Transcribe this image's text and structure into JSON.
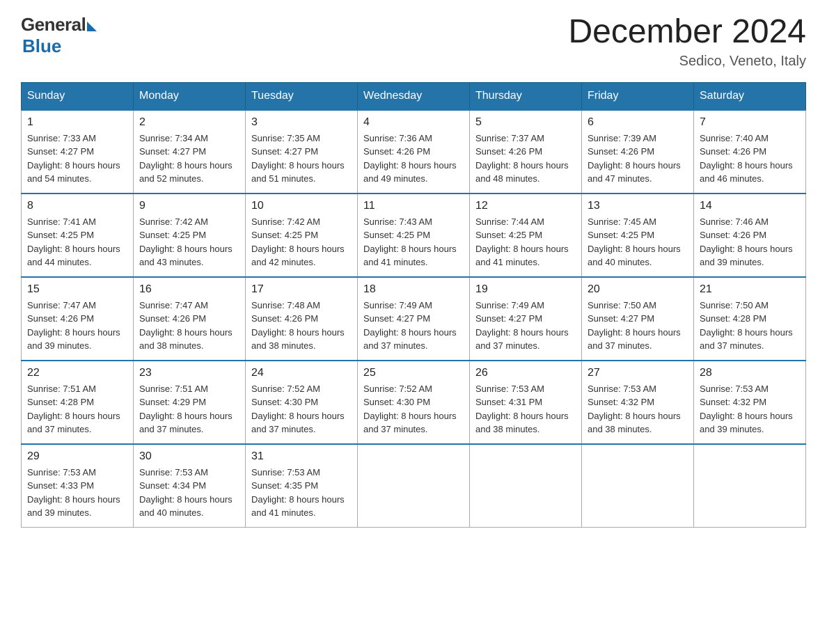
{
  "logo": {
    "general": "General",
    "blue": "Blue",
    "subtitle": "Blue"
  },
  "header": {
    "month": "December 2024",
    "location": "Sedico, Veneto, Italy"
  },
  "days_of_week": [
    "Sunday",
    "Monday",
    "Tuesday",
    "Wednesday",
    "Thursday",
    "Friday",
    "Saturday"
  ],
  "weeks": [
    [
      {
        "day": "1",
        "sunrise": "7:33 AM",
        "sunset": "4:27 PM",
        "daylight": "8 hours and 54 minutes."
      },
      {
        "day": "2",
        "sunrise": "7:34 AM",
        "sunset": "4:27 PM",
        "daylight": "8 hours and 52 minutes."
      },
      {
        "day": "3",
        "sunrise": "7:35 AM",
        "sunset": "4:27 PM",
        "daylight": "8 hours and 51 minutes."
      },
      {
        "day": "4",
        "sunrise": "7:36 AM",
        "sunset": "4:26 PM",
        "daylight": "8 hours and 49 minutes."
      },
      {
        "day": "5",
        "sunrise": "7:37 AM",
        "sunset": "4:26 PM",
        "daylight": "8 hours and 48 minutes."
      },
      {
        "day": "6",
        "sunrise": "7:39 AM",
        "sunset": "4:26 PM",
        "daylight": "8 hours and 47 minutes."
      },
      {
        "day": "7",
        "sunrise": "7:40 AM",
        "sunset": "4:26 PM",
        "daylight": "8 hours and 46 minutes."
      }
    ],
    [
      {
        "day": "8",
        "sunrise": "7:41 AM",
        "sunset": "4:25 PM",
        "daylight": "8 hours and 44 minutes."
      },
      {
        "day": "9",
        "sunrise": "7:42 AM",
        "sunset": "4:25 PM",
        "daylight": "8 hours and 43 minutes."
      },
      {
        "day": "10",
        "sunrise": "7:42 AM",
        "sunset": "4:25 PM",
        "daylight": "8 hours and 42 minutes."
      },
      {
        "day": "11",
        "sunrise": "7:43 AM",
        "sunset": "4:25 PM",
        "daylight": "8 hours and 41 minutes."
      },
      {
        "day": "12",
        "sunrise": "7:44 AM",
        "sunset": "4:25 PM",
        "daylight": "8 hours and 41 minutes."
      },
      {
        "day": "13",
        "sunrise": "7:45 AM",
        "sunset": "4:25 PM",
        "daylight": "8 hours and 40 minutes."
      },
      {
        "day": "14",
        "sunrise": "7:46 AM",
        "sunset": "4:26 PM",
        "daylight": "8 hours and 39 minutes."
      }
    ],
    [
      {
        "day": "15",
        "sunrise": "7:47 AM",
        "sunset": "4:26 PM",
        "daylight": "8 hours and 39 minutes."
      },
      {
        "day": "16",
        "sunrise": "7:47 AM",
        "sunset": "4:26 PM",
        "daylight": "8 hours and 38 minutes."
      },
      {
        "day": "17",
        "sunrise": "7:48 AM",
        "sunset": "4:26 PM",
        "daylight": "8 hours and 38 minutes."
      },
      {
        "day": "18",
        "sunrise": "7:49 AM",
        "sunset": "4:27 PM",
        "daylight": "8 hours and 37 minutes."
      },
      {
        "day": "19",
        "sunrise": "7:49 AM",
        "sunset": "4:27 PM",
        "daylight": "8 hours and 37 minutes."
      },
      {
        "day": "20",
        "sunrise": "7:50 AM",
        "sunset": "4:27 PM",
        "daylight": "8 hours and 37 minutes."
      },
      {
        "day": "21",
        "sunrise": "7:50 AM",
        "sunset": "4:28 PM",
        "daylight": "8 hours and 37 minutes."
      }
    ],
    [
      {
        "day": "22",
        "sunrise": "7:51 AM",
        "sunset": "4:28 PM",
        "daylight": "8 hours and 37 minutes."
      },
      {
        "day": "23",
        "sunrise": "7:51 AM",
        "sunset": "4:29 PM",
        "daylight": "8 hours and 37 minutes."
      },
      {
        "day": "24",
        "sunrise": "7:52 AM",
        "sunset": "4:30 PM",
        "daylight": "8 hours and 37 minutes."
      },
      {
        "day": "25",
        "sunrise": "7:52 AM",
        "sunset": "4:30 PM",
        "daylight": "8 hours and 37 minutes."
      },
      {
        "day": "26",
        "sunrise": "7:53 AM",
        "sunset": "4:31 PM",
        "daylight": "8 hours and 38 minutes."
      },
      {
        "day": "27",
        "sunrise": "7:53 AM",
        "sunset": "4:32 PM",
        "daylight": "8 hours and 38 minutes."
      },
      {
        "day": "28",
        "sunrise": "7:53 AM",
        "sunset": "4:32 PM",
        "daylight": "8 hours and 39 minutes."
      }
    ],
    [
      {
        "day": "29",
        "sunrise": "7:53 AM",
        "sunset": "4:33 PM",
        "daylight": "8 hours and 39 minutes."
      },
      {
        "day": "30",
        "sunrise": "7:53 AM",
        "sunset": "4:34 PM",
        "daylight": "8 hours and 40 minutes."
      },
      {
        "day": "31",
        "sunrise": "7:53 AM",
        "sunset": "4:35 PM",
        "daylight": "8 hours and 41 minutes."
      },
      null,
      null,
      null,
      null
    ]
  ],
  "labels": {
    "sunrise": "Sunrise:",
    "sunset": "Sunset:",
    "daylight": "Daylight:"
  }
}
